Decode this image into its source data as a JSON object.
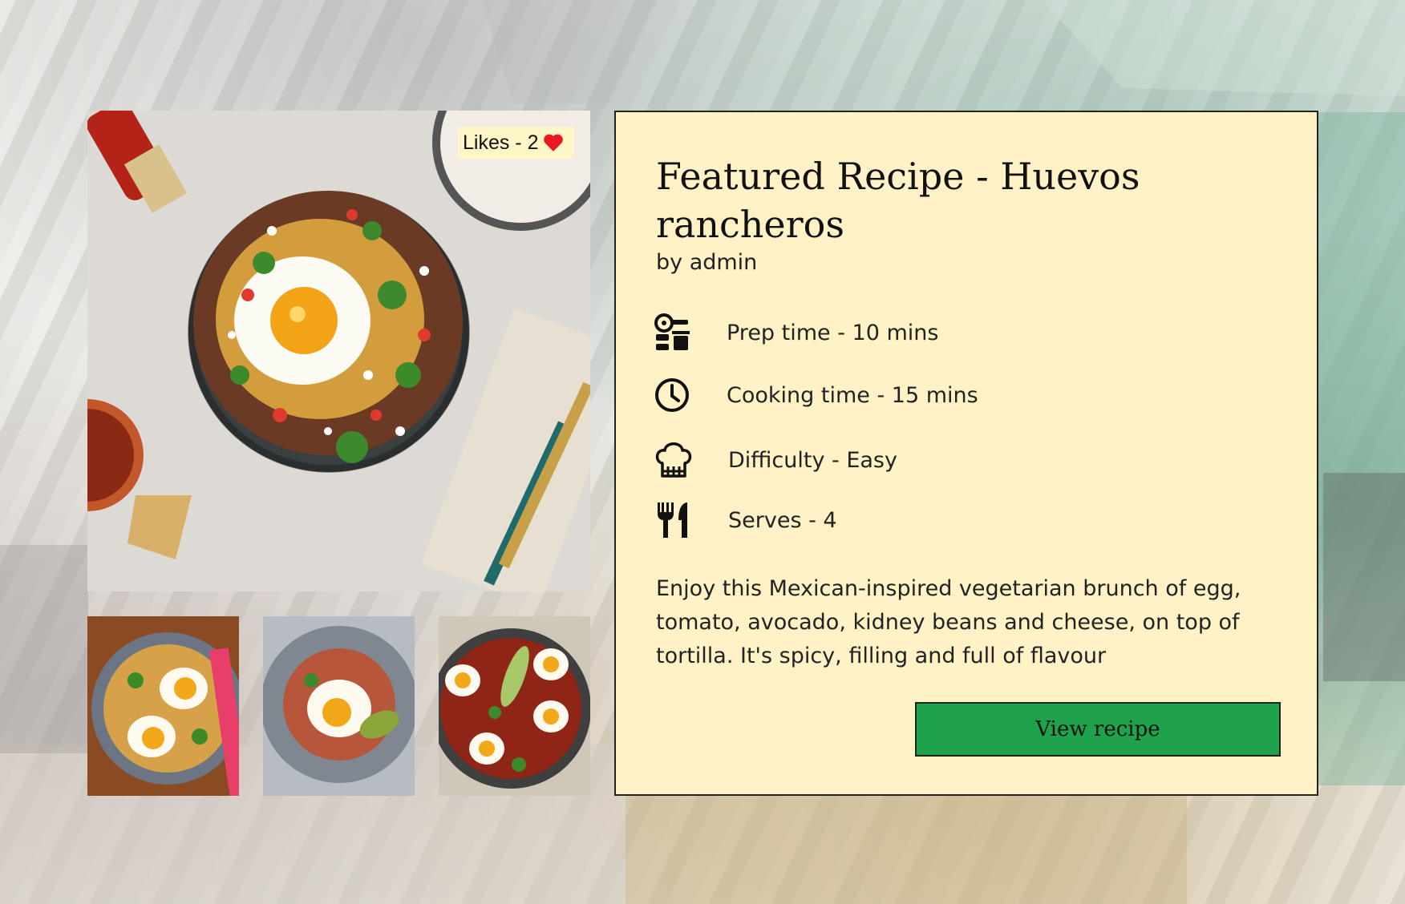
{
  "recipe": {
    "title": "Featured Recipe - Huevos rancheros",
    "author": "by admin",
    "likes": "Likes - 2",
    "prep_time": "Prep time - 10 mins",
    "cooking_time": "Cooking time - 15 mins",
    "difficulty": "Difficulty - Easy",
    "serves": "Serves - 4",
    "description": "Enjoy this Mexican-inspired vegetarian brunch of egg, tomato, avocado, kidney beans and cheese, on top of tortilla. It's spicy, filling and full of flavour",
    "button_label": "View recipe"
  },
  "colors": {
    "card_bg": "#fff2c7",
    "button_bg": "#1ea24c",
    "heart": "#e8191f",
    "likes_bg": "#fff6c8"
  },
  "icons": {
    "prep": "kitchen-scale-icon",
    "cook": "clock-icon",
    "difficulty": "chef-hat-icon",
    "serves": "fork-knife-icon",
    "likes": "heart-icon"
  }
}
